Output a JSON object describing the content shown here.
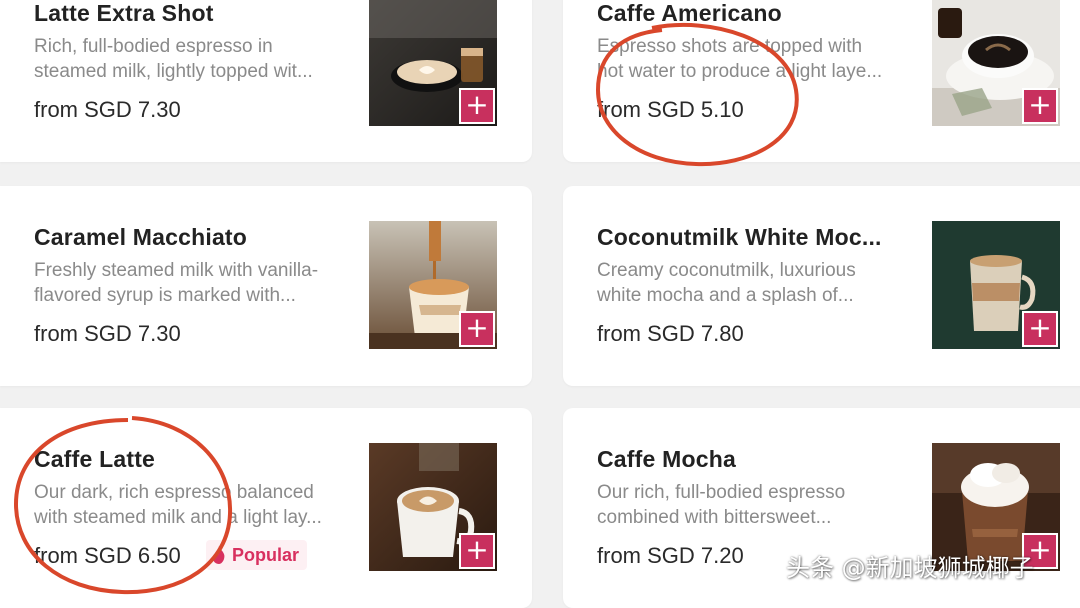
{
  "products": [
    {
      "name": "Latte Extra Shot",
      "desc_line1": "Rich, full-bodied espresso in",
      "desc_line2": "steamed milk, lightly topped wit...",
      "price": "from SGD 7.30",
      "image_icon": "latte-extra-shot-photo"
    },
    {
      "name": "Caffe Americano",
      "desc_line1": "Espresso shots are topped with",
      "desc_line2": "hot water to produce a light laye...",
      "price": "from SGD 5.10",
      "image_icon": "caffe-americano-photo"
    },
    {
      "name": "Caramel Macchiato",
      "desc_line1": "Freshly steamed milk with vanilla-",
      "desc_line2": "flavored syrup is marked with...",
      "price": "from SGD 7.30",
      "image_icon": "caramel-macchiato-photo"
    },
    {
      "name": "Coconutmilk White Moc...",
      "desc_line1": "Creamy coconutmilk, luxurious",
      "desc_line2": "white mocha and a splash of...",
      "price": "from SGD 7.80",
      "image_icon": "coconutmilk-white-mocha-photo"
    },
    {
      "name": "Caffe Latte",
      "desc_line1": "Our dark, rich espresso balanced",
      "desc_line2": "with steamed milk and a light lay...",
      "price": "from SGD 6.50",
      "badge": "Popular",
      "image_icon": "caffe-latte-photo"
    },
    {
      "name": "Caffe Mocha",
      "desc_line1": "Our rich, full-bodied espresso",
      "desc_line2": "combined with bittersweet...",
      "price": "from SGD 7.20",
      "image_icon": "caffe-mocha-photo"
    }
  ],
  "add_button_label": "+",
  "watermark": "头条 @新加坡狮城椰子",
  "colors": {
    "accent": "#c8305e",
    "annotation_circle": "#d9472b",
    "badge_bg": "#fdf0f3",
    "badge_text": "#d8305f"
  }
}
